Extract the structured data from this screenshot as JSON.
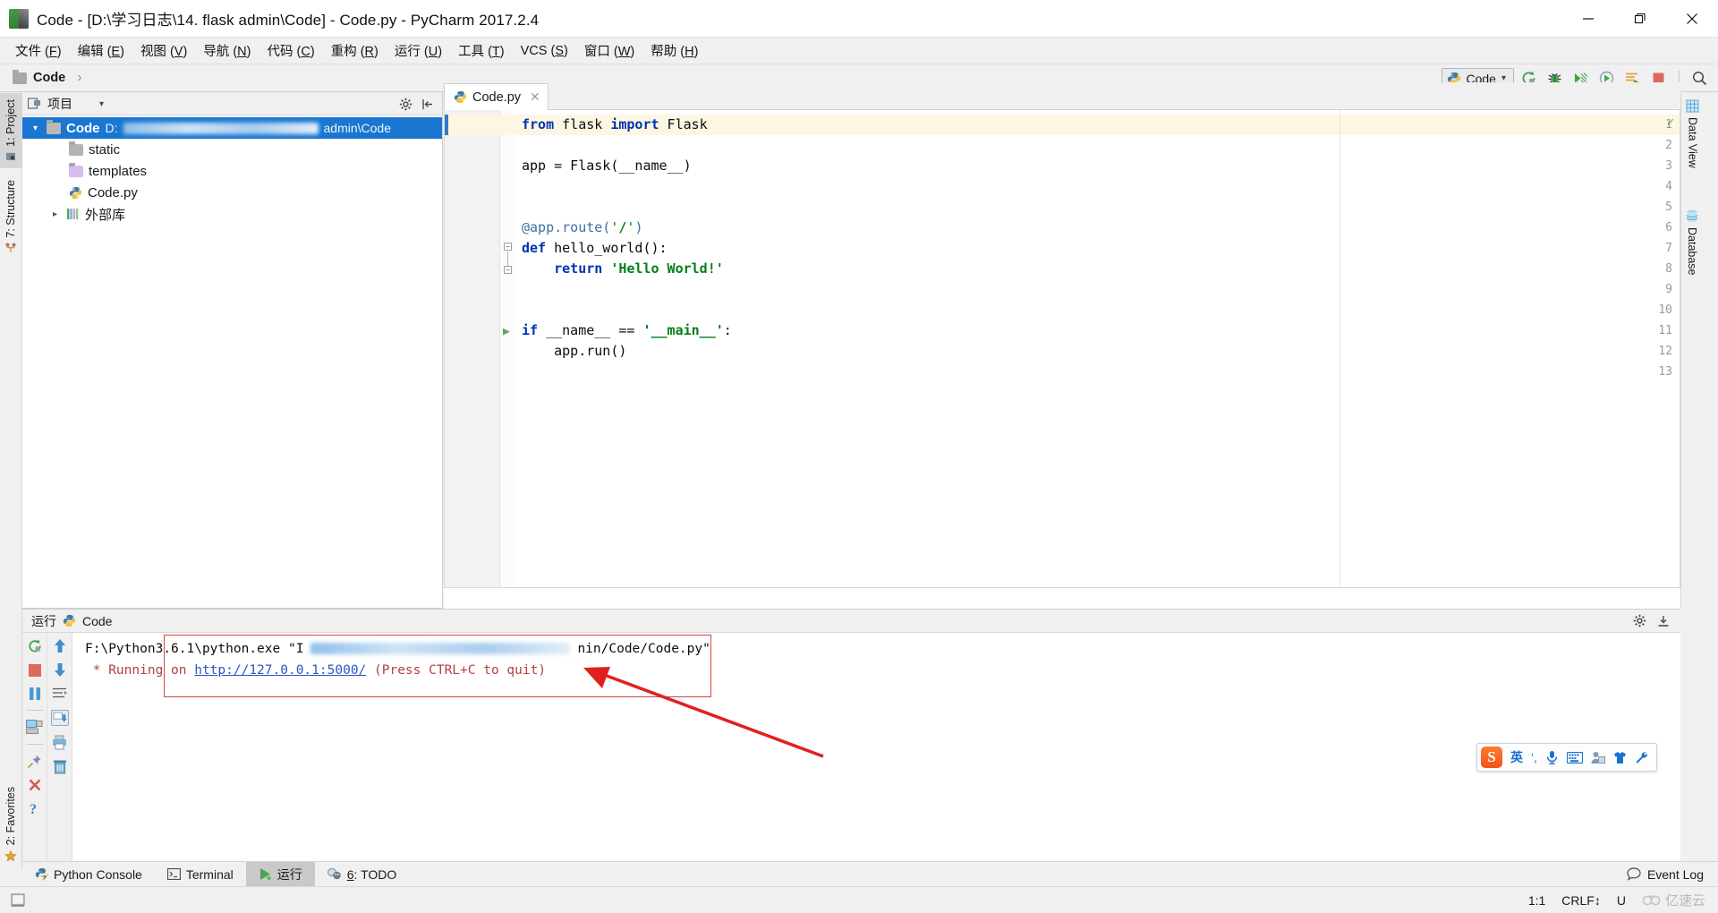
{
  "window": {
    "title": "Code - [D:\\学习日志\\14. flask admin\\Code] - Code.py - PyCharm 2017.2.4",
    "app_icon": "pycharm-icon",
    "minimize_label": "—",
    "maximize_label": "❐",
    "close_label": "✕"
  },
  "menubar": {
    "items": [
      {
        "label": "文件",
        "mnemonic": "F"
      },
      {
        "label": "编辑",
        "mnemonic": "E"
      },
      {
        "label": "视图",
        "mnemonic": "V"
      },
      {
        "label": "导航",
        "mnemonic": "N"
      },
      {
        "label": "代码",
        "mnemonic": "C"
      },
      {
        "label": "重构",
        "mnemonic": "R"
      },
      {
        "label": "运行",
        "mnemonic": "U"
      },
      {
        "label": "工具",
        "mnemonic": "T"
      },
      {
        "label": "VCS",
        "mnemonic": "S"
      },
      {
        "label": "窗口",
        "mnemonic": "W"
      },
      {
        "label": "帮助",
        "mnemonic": "H"
      }
    ]
  },
  "navbar": {
    "breadcrumb": "Code",
    "breadcrumb_sep": "›",
    "run_config": "Code",
    "run_config_caret": "⌄",
    "buttons": [
      {
        "name": "run-button",
        "glyph": "run"
      },
      {
        "name": "debug-button",
        "glyph": "debug"
      },
      {
        "name": "coverage-button",
        "glyph": "coverage"
      },
      {
        "name": "profile-button",
        "glyph": "profile"
      },
      {
        "name": "run-with-console-button",
        "glyph": "console"
      },
      {
        "name": "stop-button",
        "glyph": "stop"
      },
      {
        "name": "search-everywhere-button",
        "glyph": "search"
      }
    ]
  },
  "left_tabs": [
    {
      "label": "1: Project",
      "active": true,
      "icon": "project-icon"
    },
    {
      "label": "7: Structure",
      "active": false,
      "icon": "structure-icon"
    }
  ],
  "left_bottom_tabs": [
    {
      "label": "2: Favorites",
      "active": false,
      "icon": "star-icon"
    }
  ],
  "right_tabs": [
    {
      "label": "Data View",
      "active": false,
      "icon": "grid-icon"
    },
    {
      "label": "Database",
      "active": false,
      "icon": "database-icon"
    }
  ],
  "project": {
    "header_title": "项目",
    "header_caret": "▾",
    "settings_icon": "gear-icon",
    "collapse_icon": "collapse-all-icon",
    "tree": [
      {
        "label": "Code",
        "path_prefix": "D:",
        "path_suffix": "admin\\Code",
        "type": "root",
        "selected": true,
        "expanded": true,
        "indent": 0
      },
      {
        "label": "static",
        "type": "folder-static",
        "selected": false,
        "indent": 1
      },
      {
        "label": "templates",
        "type": "folder-templates",
        "selected": false,
        "indent": 1
      },
      {
        "label": "Code.py",
        "type": "python-file",
        "selected": false,
        "indent": 1
      },
      {
        "label": "外部库",
        "type": "library",
        "selected": false,
        "expanded": false,
        "indent": 0
      }
    ]
  },
  "editor": {
    "tab": {
      "label": "Code.py",
      "icon": "python-file-icon",
      "close": "✕"
    },
    "inspection_status": "✓",
    "current_line": 1,
    "lines": [
      {
        "n": 1,
        "tokens": [
          {
            "t": "from",
            "c": "kw"
          },
          {
            "t": " flask ",
            "c": ""
          },
          {
            "t": "import",
            "c": "kw"
          },
          {
            "t": " Flask",
            "c": ""
          }
        ]
      },
      {
        "n": 2,
        "tokens": []
      },
      {
        "n": 3,
        "tokens": [
          {
            "t": "app = Flask(__name__)",
            "c": ""
          }
        ]
      },
      {
        "n": 4,
        "tokens": []
      },
      {
        "n": 5,
        "tokens": []
      },
      {
        "n": 6,
        "tokens": [
          {
            "t": "@app.route(",
            "c": "dec"
          },
          {
            "t": "'",
            "c": "str"
          },
          {
            "t": "/",
            "c": "strb"
          },
          {
            "t": "'",
            "c": "str"
          },
          {
            "t": ")",
            "c": "dec"
          }
        ]
      },
      {
        "n": 7,
        "tokens": [
          {
            "t": "def",
            "c": "kw"
          },
          {
            "t": " hello_world():",
            "c": ""
          }
        ]
      },
      {
        "n": 8,
        "tokens": [
          {
            "t": "    ",
            "c": ""
          },
          {
            "t": "return",
            "c": "kw"
          },
          {
            "t": " ",
            "c": ""
          },
          {
            "t": "'Hello World!'",
            "c": "strb"
          }
        ]
      },
      {
        "n": 9,
        "tokens": []
      },
      {
        "n": 10,
        "tokens": []
      },
      {
        "n": 11,
        "tokens": [
          {
            "t": "if",
            "c": "kw"
          },
          {
            "t": " __name__ == ",
            "c": ""
          },
          {
            "t": "'__main__'",
            "c": "strb"
          },
          {
            "t": ":",
            "c": ""
          }
        ],
        "gutter_marker": "run-arrow"
      },
      {
        "n": 12,
        "tokens": [
          {
            "t": "    app.run()",
            "c": ""
          }
        ]
      },
      {
        "n": 13,
        "tokens": []
      }
    ]
  },
  "run_panel": {
    "title": "运行",
    "config_name": "Code",
    "settings_icon": "gear-icon",
    "hide_icon": "hide-icon",
    "side_buttons_col1": [
      {
        "name": "rerun-button",
        "glyph": "rerun"
      },
      {
        "name": "stop-button",
        "glyph": "stop"
      },
      {
        "name": "pause-button",
        "glyph": "pause"
      },
      {
        "name": "show-console-button",
        "glyph": "console"
      },
      {
        "name": "pin-tab-button",
        "glyph": "pin"
      },
      {
        "name": "close-button",
        "glyph": "close"
      },
      {
        "name": "help-button",
        "glyph": "help"
      }
    ],
    "side_buttons_col2": [
      {
        "name": "up-stacktrace-button",
        "glyph": "up"
      },
      {
        "name": "down-stacktrace-button",
        "glyph": "down"
      },
      {
        "name": "soft-wrap-button",
        "glyph": "wrap"
      },
      {
        "name": "scroll-to-end-button",
        "glyph": "scroll-end"
      },
      {
        "name": "print-button",
        "glyph": "print"
      },
      {
        "name": "clear-all-button",
        "glyph": "trash"
      }
    ],
    "console": {
      "line1_prefix": "F:\\Python3.6.1\\python.exe \"I",
      "line1_suffix": "nin/Code/Code.py\"",
      "line2_star": " * Running on ",
      "line2_url": "http://127.0.0.1:5000/",
      "line2_tail": " (Press CTRL+C to quit)"
    }
  },
  "ime": {
    "logo": "S",
    "items": [
      {
        "name": "language-mode",
        "label": "英"
      },
      {
        "name": "punctuation-mode",
        "label": "‘’"
      },
      {
        "name": "voice-input-icon",
        "label": "mic"
      },
      {
        "name": "soft-keyboard-icon",
        "label": "keyboard"
      },
      {
        "name": "user-icon",
        "label": "user"
      },
      {
        "name": "skin-icon",
        "label": "shirt"
      },
      {
        "name": "toolbox-icon",
        "label": "wrench"
      }
    ]
  },
  "bottom_tabs": [
    {
      "label": "Python Console",
      "active": false,
      "icon": "python-console-icon"
    },
    {
      "label": "Terminal",
      "active": false,
      "icon": "terminal-icon"
    },
    {
      "label": "运行",
      "active": true,
      "icon": "run-icon"
    },
    {
      "label": "6: TODO",
      "active": false,
      "icon": "todo-icon",
      "mnemonic": "6"
    }
  ],
  "status_bar": {
    "event_log": "Event Log",
    "event_log_icon": "balloon-icon",
    "caret_position": "1:1",
    "line_separator": "CRLF",
    "line_separator_caret": "↕",
    "encoding": "U",
    "watermark": "亿速云",
    "toggle_icon": "toggle-toolbar-icon"
  }
}
